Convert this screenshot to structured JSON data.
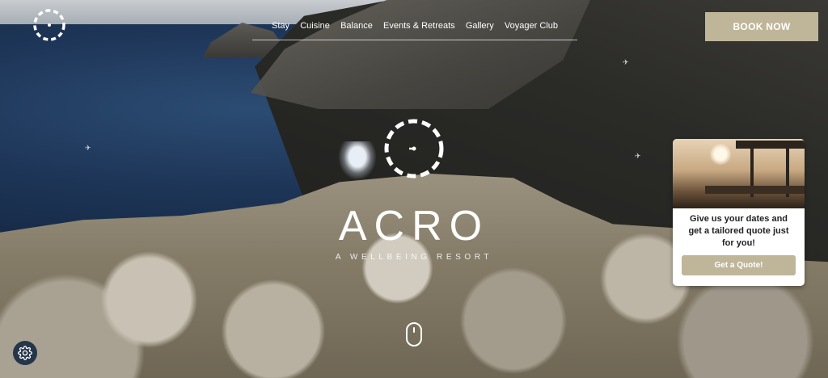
{
  "nav": {
    "items": [
      "Stay",
      "Cuisine",
      "Balance",
      "Events & Retreats",
      "Gallery",
      "Voyager Club"
    ]
  },
  "header": {
    "book_label": "BOOK NOW"
  },
  "hero": {
    "brand": "ACRO",
    "tagline": "A WELLBEING RESORT"
  },
  "quote_card": {
    "message": "Give us your dates and get a tailored quote just for you!",
    "button_label": "Get a Quote!"
  },
  "icons": {
    "logo": "clock-dashed-circle-icon",
    "scroll": "mouse-scroll-icon",
    "settings": "gear-icon"
  },
  "colors": {
    "accent": "#bfb599",
    "text_light": "#ffffff",
    "settings_bg": "#24364a"
  }
}
